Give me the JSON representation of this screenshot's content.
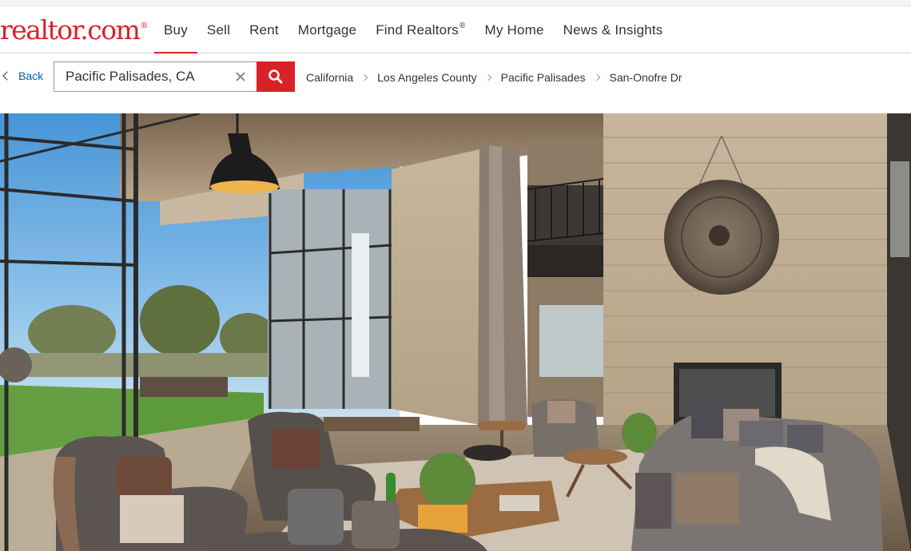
{
  "brand": {
    "logo_text": "realtor.com",
    "logo_mark": "®",
    "color": "#d92228"
  },
  "nav": {
    "items": [
      {
        "label": "Buy",
        "active": true
      },
      {
        "label": "Sell"
      },
      {
        "label": "Rent"
      },
      {
        "label": "Mortgage"
      },
      {
        "label": "Find Realtors",
        "sup": "®"
      },
      {
        "label": "My Home"
      },
      {
        "label": "News & Insights"
      }
    ]
  },
  "search": {
    "back_label": "Back",
    "value": "Pacific Palisades, CA",
    "link_color": "#0061b0"
  },
  "breadcrumb": [
    "California",
    "Los Angeles County",
    "Pacific Palisades",
    "San-Onofre Dr"
  ],
  "photo": {
    "description_icon": "listing-photo"
  }
}
